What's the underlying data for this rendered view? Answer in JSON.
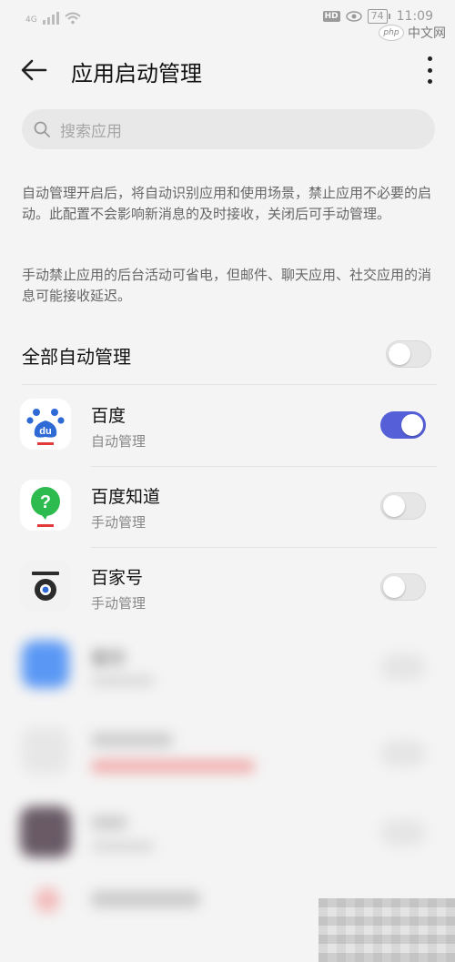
{
  "statusbar": {
    "signal": "4G",
    "hd": "HD",
    "battery": "74",
    "time": "11:09"
  },
  "watermark": {
    "logo": "php",
    "text": "中文网"
  },
  "header": {
    "title": "应用启动管理"
  },
  "search": {
    "placeholder": "搜索应用"
  },
  "descriptions": [
    "自动管理开启后，将自动识别应用和使用场景，禁止应用不必要的启动。此配置不会影响新消息的及时接收，关闭后可手动管理。",
    "手动禁止应用的后台活动可省电，但邮件、聊天应用、社交应用的消息可能接收延迟。"
  ],
  "all_auto": {
    "label": "全部自动管理",
    "enabled": false
  },
  "apps": [
    {
      "name": "百度",
      "mode": "自动管理",
      "enabled": true,
      "icon": "baidu-paw-icon"
    },
    {
      "name": "百度知道",
      "mode": "手动管理",
      "enabled": false,
      "icon": "baidu-zhidao-icon"
    },
    {
      "name": "百家号",
      "mode": "手动管理",
      "enabled": false,
      "icon": "baijiahao-icon"
    }
  ],
  "blurred_apps": [
    {
      "name": "备份",
      "mode": ""
    },
    {
      "name": "",
      "mode": ""
    },
    {
      "name": "",
      "mode": ""
    },
    {
      "name": "",
      "mode": ""
    }
  ],
  "colors": {
    "accent": "#5560d8",
    "baidu_blue": "#2e6ad6",
    "zhidao_green": "#2dbb4f",
    "baijiahao_dark": "#333333"
  }
}
